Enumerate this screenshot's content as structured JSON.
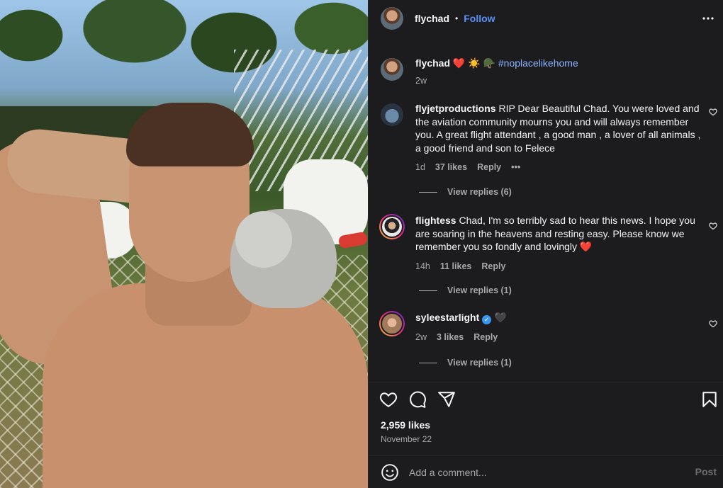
{
  "post": {
    "author": "flychad",
    "follow_label": "Follow",
    "separator": "•",
    "more_icon": "ellipsis-horizontal-icon"
  },
  "caption": {
    "username": "flychad",
    "text_emoji": "❤️ ☀️ 🪖",
    "hashtag": "#noplacelikehome",
    "age": "2w"
  },
  "comments": [
    {
      "username": "flyjetproductions",
      "text": "RIP Dear Beautiful Chad. You were loved and the aviation community mourns you and will always remember you. A great flight attendant , a good man , a lover of all animals , a good friend and son to Felece",
      "age": "1d",
      "likes": "37 likes",
      "reply_label": "Reply",
      "more": "•••",
      "view_replies": "View replies (6)"
    },
    {
      "username": "flightess",
      "text": "Chad, I'm so terribly sad to hear this news. I hope you are soaring in the heavens and resting easy. Please know we remember you so fondly and lovingly ❤️",
      "age": "14h",
      "likes": "11 likes",
      "reply_label": "Reply",
      "view_replies": "View replies (1)"
    },
    {
      "username": "syleestarlight",
      "verified": true,
      "text": "🖤",
      "age": "2w",
      "likes": "3 likes",
      "reply_label": "Reply",
      "view_replies": "View replies (1)"
    }
  ],
  "stats": {
    "likes": "2,959 likes",
    "date": "November 22"
  },
  "add_comment": {
    "placeholder": "Add a comment...",
    "post_label": "Post"
  },
  "icons": {
    "like": "heart-icon",
    "comment": "comment-icon",
    "share": "share-icon",
    "save": "bookmark-icon",
    "emoji": "emoji-icon"
  }
}
